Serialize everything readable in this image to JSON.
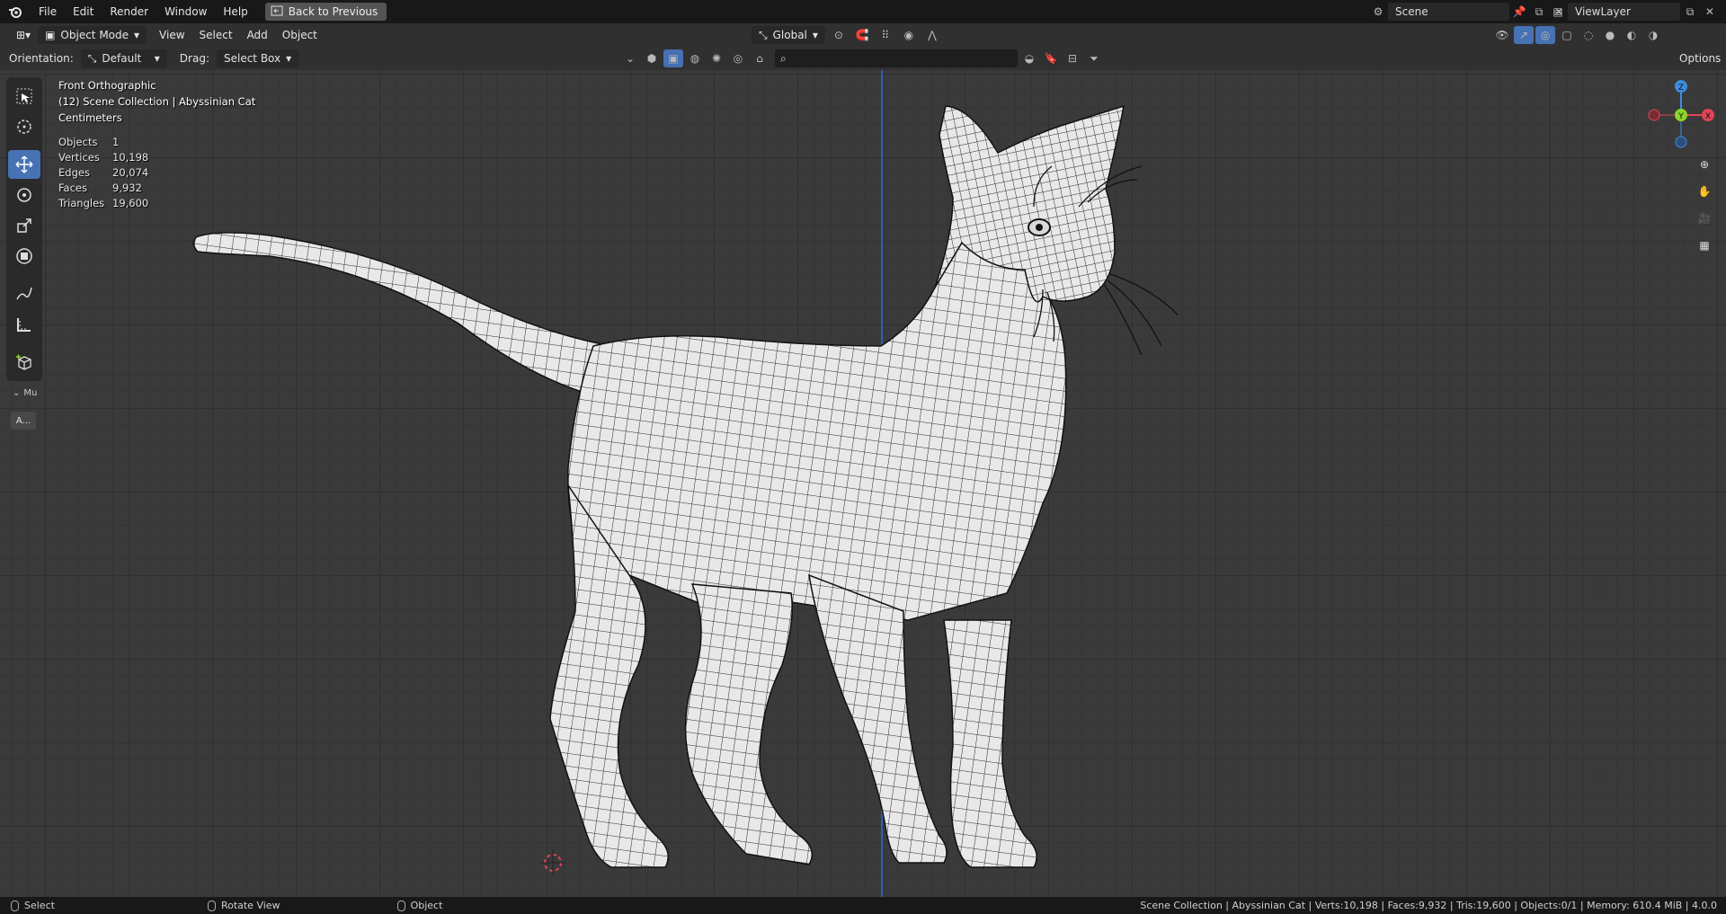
{
  "menubar": {
    "items": [
      "File",
      "Edit",
      "Render",
      "Window",
      "Help"
    ],
    "back_button": "Back to Previous",
    "scene": "Scene",
    "view_layer": "ViewLayer"
  },
  "header": {
    "mode": "Object Mode",
    "menus": [
      "View",
      "Select",
      "Add",
      "Object"
    ],
    "transform_orientation": "Global",
    "options": "Options"
  },
  "tool_settings": {
    "orientation_label": "Orientation:",
    "orientation_value": "Default",
    "drag_label": "Drag:",
    "drag_value": "Select Box"
  },
  "viewport": {
    "view_name": "Front Orthographic",
    "collection": "(12) Scene Collection | Abyssinian Cat",
    "units": "Centimeters",
    "stats": [
      {
        "label": "Objects",
        "value": "1"
      },
      {
        "label": "Vertices",
        "value": "10,198"
      },
      {
        "label": "Edges",
        "value": "20,074"
      },
      {
        "label": "Faces",
        "value": "9,932"
      },
      {
        "label": "Triangles",
        "value": "19,600"
      }
    ],
    "gizmo": {
      "z": "Z",
      "y": "Y",
      "x": "X"
    }
  },
  "toolbar": {
    "panel_label": "Mu",
    "panel_button": "A..."
  },
  "statusbar": {
    "select": "Select",
    "rotate_view": "Rotate View",
    "object": "Object",
    "info": "Scene Collection | Abyssinian Cat | Verts:10,198 | Faces:9,932 | Tris:19,600 | Objects:0/1 | Memory: 610.4 MiB | 4.0.0"
  },
  "colors": {
    "accent": "#4772b3",
    "axis_x": "#e04555",
    "axis_y": "#8bd42c",
    "axis_z": "#3d8ce0"
  }
}
